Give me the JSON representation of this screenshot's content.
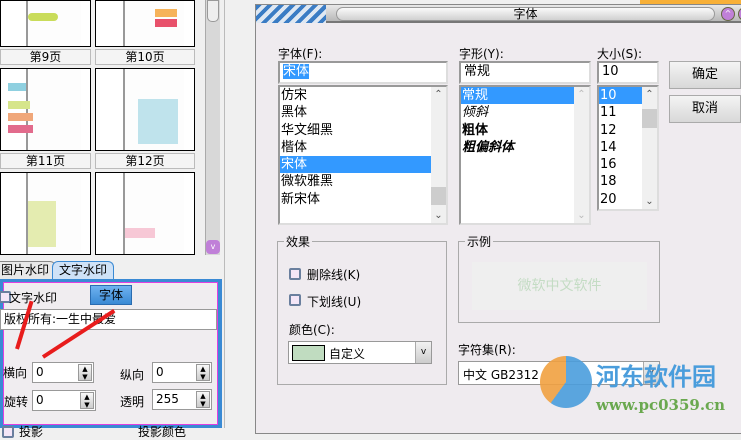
{
  "thumbnails": {
    "pages": [
      "第9页",
      "第10页",
      "第11页",
      "第12页"
    ]
  },
  "watermark_tabs": {
    "items": [
      "图片水印",
      "文字水印"
    ],
    "active": 1
  },
  "text_watermark": {
    "checkbox_label": "文字水印",
    "font_button": "字体",
    "text_value": "版权所有:一生中最爱",
    "horizontal_label": "横向",
    "horizontal_value": "0",
    "vertical_label": "纵向",
    "vertical_value": "0",
    "rotate_label": "旋转",
    "rotate_value": "0",
    "opacity_label": "透明",
    "opacity_value": "255",
    "shadow_label": "投影",
    "shadow_color_label": "投影颜色"
  },
  "dialog": {
    "title": "字体",
    "font": {
      "label": "字体(F):",
      "value": "宋体",
      "options": [
        "仿宋",
        "黑体",
        "华文细黑",
        "楷体",
        "宋体",
        "微软雅黑",
        "新宋体"
      ],
      "selected": 4
    },
    "style": {
      "label": "字形(Y):",
      "value": "常规",
      "options": [
        "常规",
        "倾斜",
        "粗体",
        "粗偏斜体"
      ],
      "selected": 0
    },
    "size": {
      "label": "大小(S):",
      "value": "10",
      "options": [
        "10",
        "11",
        "12",
        "14",
        "16",
        "18",
        "20"
      ],
      "selected": 0
    },
    "ok": "确定",
    "cancel": "取消",
    "effects": {
      "title": "效果",
      "strikeout": "删除线(K)",
      "underline": "下划线(U)",
      "color_label": "颜色(C):",
      "color_value": "自定义",
      "color_swatch": "#c0dcc0"
    },
    "sample": {
      "title": "示例",
      "text": "微软中文软件"
    },
    "charset": {
      "label": "字符集(R):",
      "value": "中文 GB2312"
    }
  },
  "watermark_logo": {
    "name": "河东软件园",
    "url": "www.pc0359.cn"
  },
  "colors": {
    "accent": "#3399ff",
    "panel_border": "#3a8ad4",
    "arrow": "#e81c1c"
  }
}
